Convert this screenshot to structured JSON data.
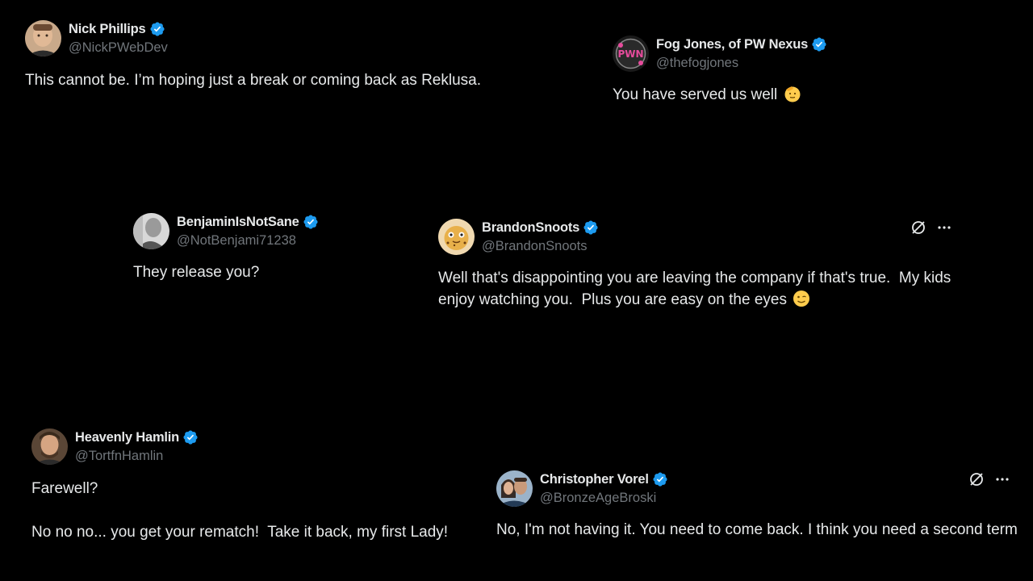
{
  "colors": {
    "background": "#000000",
    "text": "#e7e9ea",
    "muted": "#71767b",
    "verified": "#1d9bf0"
  },
  "tweets": [
    {
      "name": "Nick Phillips",
      "handle": "@NickPWebDev",
      "verified": true,
      "text": "This cannot be. I’m hoping just a break or coming back as Reklusa."
    },
    {
      "name": "Fog Jones, of PW Nexus",
      "handle": "@thefogjones",
      "verified": true,
      "text": "You have served us well",
      "emoji": "saluting-face-emoji"
    },
    {
      "name": "BenjaminIsNotSane",
      "handle": "@NotBenjami71238",
      "verified": true,
      "text": "They release you?"
    },
    {
      "name": "BrandonSnoots",
      "handle": "@BrandonSnoots",
      "verified": true,
      "text": "Well that's disappointing you are leaving the company if that's true.  My kids enjoy watching you.  Plus you are easy on the eyes",
      "emoji": "winking-face-emoji",
      "actions": [
        "grok-icon",
        "more-icon"
      ]
    },
    {
      "name": "Heavenly Hamlin",
      "handle": "@TortfnHamlin",
      "verified": true,
      "text": "Farewell?\n\nNo no no... you get your rematch!  Take it back, my first Lady!"
    },
    {
      "name": "Christopher Vorel",
      "handle": "@BronzeAgeBroski",
      "verified": true,
      "text": "No, I'm not having it. You need to come back. I think you need a second term",
      "actions": [
        "grok-icon",
        "more-icon"
      ]
    }
  ]
}
